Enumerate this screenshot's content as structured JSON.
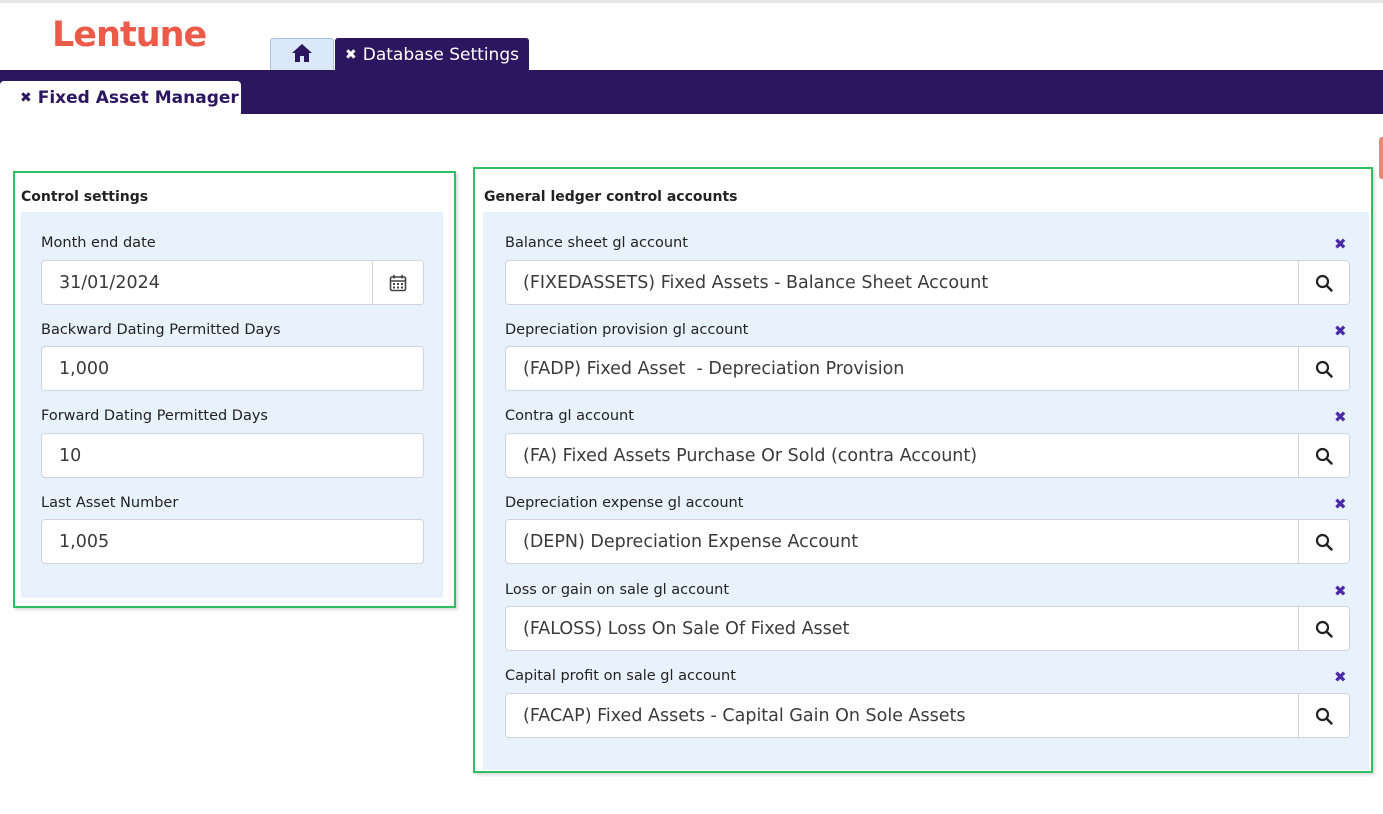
{
  "app": {
    "logo": "Lentune"
  },
  "tabs": {
    "home_icon": "home-icon",
    "database_settings": "Database Settings",
    "fixed_asset_manager": "Fixed Asset Manager",
    "close_glyph": "✖"
  },
  "control_settings": {
    "title": "Control settings",
    "fields": [
      {
        "label": "Month end date",
        "value": "31/01/2024",
        "icon": "calendar-icon"
      },
      {
        "label": "Backward Dating Permitted Days",
        "value": "1,000"
      },
      {
        "label": "Forward Dating Permitted Days",
        "value": "10"
      },
      {
        "label": "Last Asset Number",
        "value": "1,005"
      }
    ]
  },
  "gl_accounts": {
    "title": "General ledger control accounts",
    "clear_glyph": "✖",
    "fields": [
      {
        "label": "Balance sheet gl account",
        "value": "(FIXEDASSETS) Fixed Assets - Balance Sheet Account"
      },
      {
        "label": "Depreciation provision gl account",
        "value": "(FADP) Fixed Asset  - Depreciation Provision"
      },
      {
        "label": "Contra gl account",
        "value": "(FA) Fixed Assets Purchase Or Sold (contra Account)"
      },
      {
        "label": "Depreciation expense gl account",
        "value": "(DEPN) Depreciation Expense Account"
      },
      {
        "label": "Loss or gain on sale gl account",
        "value": "(FALOSS) Loss On Sale Of Fixed Asset"
      },
      {
        "label": "Capital profit on sale gl account",
        "value": "(FACAP) Fixed Assets - Capital Gain On Sole Assets"
      }
    ]
  },
  "colors": {
    "brand": "#ec5b4a",
    "nav": "#2d1660",
    "highlight_border": "#2fbf62",
    "panel_bg": "#e8f2fd"
  }
}
